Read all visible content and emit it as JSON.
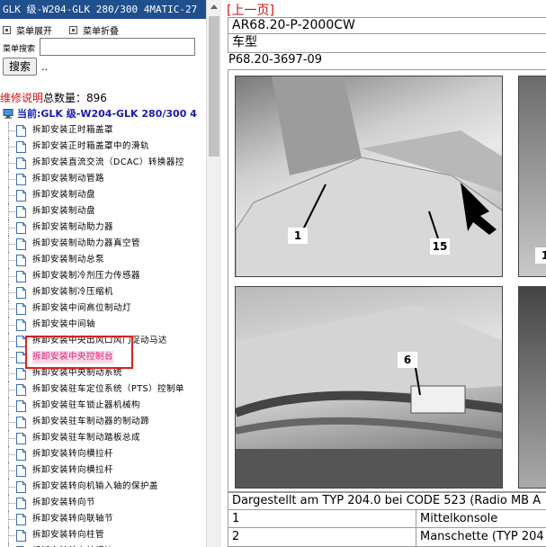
{
  "left_panel": {
    "title": "GLK 级-W204-GLK 280/300 4MATIC-27",
    "expand_label": "菜单展开",
    "collapse_label": "菜单折叠",
    "search_label": "菜单搜索",
    "search_value": "",
    "search_button": "搜索",
    "search_dots": "..",
    "count_label": "维修说明",
    "count_text": "总数量：",
    "count_value": "896",
    "current_label": "当前:GLK 级-W204-GLK 280/300 4",
    "tree_items": [
      "拆卸安装正时箱盖罩",
      "拆卸安装正时箱盖罩中的滑轨",
      "拆卸安装直流交流（DCAC）转换器控",
      "拆卸安装制动管路",
      "拆卸安装制动盘",
      "拆卸安装制动盘",
      "拆卸安装制动助力器",
      "拆卸安装制动助力器真空管",
      "拆卸安装制动总泵",
      "拆卸安装制冷剂压力传感器",
      "拆卸安装制冷压缩机",
      "拆卸安装中间高位制动灯",
      "拆卸安装中间轴",
      "拆卸安装中央出风口风门促动马达",
      "拆卸安装中央控制台",
      "拆卸安装中央制动系统",
      "拆卸安装驻车定位系统（PTS）控制单",
      "拆卸安装驻车锁止器机械构",
      "拆卸安装驻车制动器的制动蹄",
      "拆卸安装驻车制动踏板总成",
      "拆卸安装转向横拉杆",
      "拆卸安装转向横拉杆",
      "拆卸安装转向机输入轴的保护盖",
      "拆卸安装转向节",
      "拆卸安装转向联轴节",
      "拆卸安装转向柱管",
      "拆卸安装转向柱模块"
    ]
  },
  "right_panel": {
    "prev_link": "[上一页]",
    "doc_code": "AR68.20-P-2000CW",
    "model_label": "车型",
    "figure_id": "P68.20-3697-09",
    "callouts": [
      "1",
      "15",
      "1",
      "6"
    ],
    "caption": "Dargestellt am TYP 204.0 bei CODE 523 (Radio MB A",
    "parts": [
      {
        "num": "1",
        "name": "Mittelkonsole"
      },
      {
        "num": "2",
        "name": "Manschette (TYP 204"
      }
    ]
  }
}
